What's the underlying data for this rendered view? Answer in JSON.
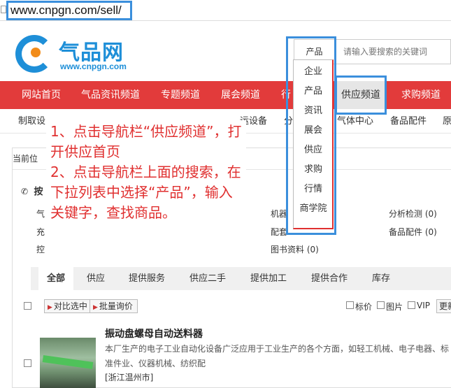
{
  "browser": {
    "url": "www.cnpgn.com/sell/"
  },
  "logo": {
    "name": "气品网",
    "domain": "www.cnpgn.com"
  },
  "search": {
    "selected": "产品",
    "placeholder": "请输入要搜索的关键词"
  },
  "nav": {
    "items": [
      "网站首页",
      "气品资讯频道",
      "专题频道",
      "展会频道",
      "行",
      "供应频道",
      "求购频道"
    ]
  },
  "subnav": {
    "items": [
      "制取设",
      "",
      "运设备",
      "分",
      "气体中心",
      "备品配件",
      "原"
    ]
  },
  "breadcrumb": "当前位",
  "category": {
    "heading": "按",
    "left": [
      "气",
      "充",
      "控"
    ],
    "mid": [
      "机器",
      "配套",
      "图书资料 (0)"
    ],
    "right": [
      "分析检测 (0)",
      "备品配件 (0)"
    ]
  },
  "tabs": [
    "全部",
    "供应",
    "提供服务",
    "供应二手",
    "提供加工",
    "提供合作",
    "库存"
  ],
  "toolbar": {
    "compare": "对比选中",
    "inquiry": "批量询价",
    "options": [
      "标价",
      "图片",
      "VIP"
    ],
    "more": "更新"
  },
  "product": {
    "title": "振动盘螺母自动送料器",
    "desc": "本厂生产的电子工业自动化设备广泛应用于工业生产的各个方面，如轻工机械、电子电器、标准件业、仪器机械、纺织配",
    "location": "[浙江温州市]"
  },
  "dropdown": {
    "items": [
      "企业",
      "产品",
      "资讯",
      "展会",
      "供应",
      "求购",
      "行情",
      "商学院"
    ]
  },
  "instructions": [
    "1、点击导航栏“供应频道”，打开供应首页",
    "2、点击导航栏上面的搜索，在下拉列表中选择“产品”，输入关键字，查找商品。"
  ],
  "colors": {
    "nav_red": "#e23b3b",
    "annotation_red": "#e03030",
    "highlight_blue": "#3b8fdc",
    "brand_blue": "#1e8fd8",
    "brand_orange": "#f28c1a"
  }
}
